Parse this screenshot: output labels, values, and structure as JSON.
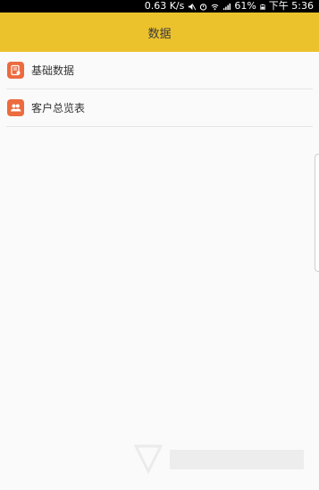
{
  "status_bar": {
    "net_speed": "0.63 K/s",
    "battery": "61%",
    "time": "下午 5:36"
  },
  "app_bar": {
    "title": "数据"
  },
  "menu": {
    "items": [
      {
        "label": "基础数据",
        "icon": "document-chart-icon"
      },
      {
        "label": "客户总览表",
        "icon": "people-icon"
      }
    ]
  },
  "colors": {
    "app_bar": "#ecc22c",
    "icon_bg": "#ec6b3f",
    "background": "#fafafa"
  }
}
